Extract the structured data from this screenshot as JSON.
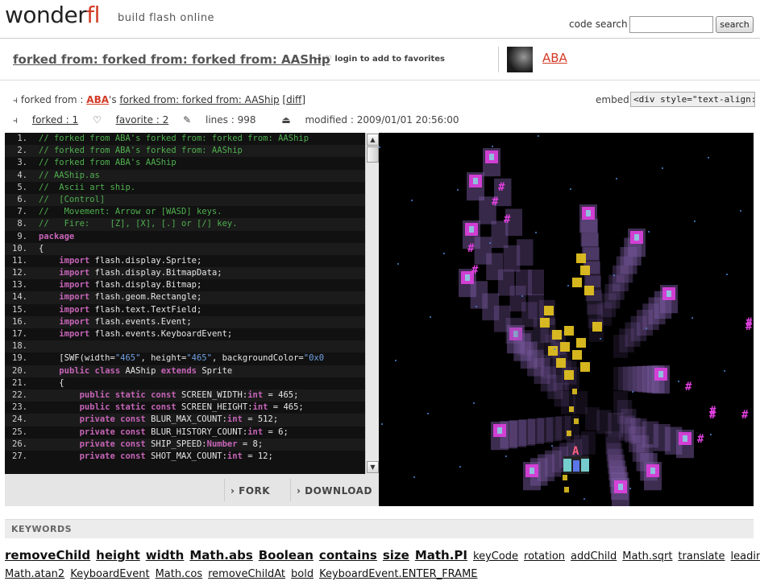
{
  "header": {
    "logo_main": "wonder",
    "logo_accent": "fl",
    "tagline": "build flash online",
    "search_label": "code search",
    "search_button": "search"
  },
  "title": {
    "text": "forked from: forked from: forked from: AAShip",
    "favorite_link": "login to add to favorites",
    "author": "ABA"
  },
  "info": {
    "forked_from_label": "forked from :",
    "forked_from_user": "ABA",
    "possessive": "'s",
    "forked_from_title": "forked from: forked from: AAShip",
    "diff": "[diff]",
    "embed_label": "embed",
    "embed_value": "<div style=\"text-align:center",
    "forked_count": "forked : 1",
    "favorite_count": "favorite : 2",
    "lines": "lines : 998",
    "modified": "modified : 2009/01/01 20:56:00"
  },
  "code": {
    "lines": [
      {
        "n": "1.",
        "parts": [
          {
            "t": "// forked from ABA's forked from: forked from: AAShip",
            "c": "com"
          }
        ]
      },
      {
        "n": "2.",
        "parts": [
          {
            "t": "// forked from ABA's forked from: AAShip",
            "c": "com"
          }
        ]
      },
      {
        "n": "3.",
        "parts": [
          {
            "t": "// forked from ABA's AAShip",
            "c": "com"
          }
        ]
      },
      {
        "n": "4.",
        "parts": [
          {
            "t": "// AAShip.as",
            "c": "com"
          }
        ]
      },
      {
        "n": "5.",
        "parts": [
          {
            "t": "//  Ascii art ship.",
            "c": "com"
          }
        ]
      },
      {
        "n": "6.",
        "parts": [
          {
            "t": "//  [Control]",
            "c": "com"
          }
        ]
      },
      {
        "n": "7.",
        "parts": [
          {
            "t": "//   Movement: Arrow or [WASD] keys.",
            "c": "com"
          }
        ]
      },
      {
        "n": "8.",
        "parts": [
          {
            "t": "//   Fire:    [Z], [X], [.] or [/] key.",
            "c": "com"
          }
        ]
      },
      {
        "n": "9.",
        "parts": [
          {
            "t": "package",
            "c": "kw"
          }
        ]
      },
      {
        "n": "10.",
        "parts": [
          {
            "t": "{",
            "c": ""
          }
        ]
      },
      {
        "n": "11.",
        "parts": [
          {
            "t": "    ",
            "c": ""
          },
          {
            "t": "import",
            "c": "kw"
          },
          {
            "t": " flash.display.Sprite;",
            "c": ""
          }
        ]
      },
      {
        "n": "12.",
        "parts": [
          {
            "t": "    ",
            "c": ""
          },
          {
            "t": "import",
            "c": "kw"
          },
          {
            "t": " flash.display.BitmapData;",
            "c": ""
          }
        ]
      },
      {
        "n": "13.",
        "parts": [
          {
            "t": "    ",
            "c": ""
          },
          {
            "t": "import",
            "c": "kw"
          },
          {
            "t": " flash.display.Bitmap;",
            "c": ""
          }
        ]
      },
      {
        "n": "14.",
        "parts": [
          {
            "t": "    ",
            "c": ""
          },
          {
            "t": "import",
            "c": "kw"
          },
          {
            "t": " flash.geom.Rectangle;",
            "c": ""
          }
        ]
      },
      {
        "n": "15.",
        "parts": [
          {
            "t": "    ",
            "c": ""
          },
          {
            "t": "import",
            "c": "kw"
          },
          {
            "t": " flash.text.TextField;",
            "c": ""
          }
        ]
      },
      {
        "n": "16.",
        "parts": [
          {
            "t": "    ",
            "c": ""
          },
          {
            "t": "import",
            "c": "kw"
          },
          {
            "t": " flash.events.Event;",
            "c": ""
          }
        ]
      },
      {
        "n": "17.",
        "parts": [
          {
            "t": "    ",
            "c": ""
          },
          {
            "t": "import",
            "c": "kw"
          },
          {
            "t": " flash.events.KeyboardEvent;",
            "c": ""
          }
        ]
      },
      {
        "n": "18.",
        "parts": [
          {
            "t": "",
            "c": ""
          }
        ]
      },
      {
        "n": "19.",
        "parts": [
          {
            "t": "    [SWF(width=",
            "c": ""
          },
          {
            "t": "\"465\"",
            "c": "str"
          },
          {
            "t": ", height=",
            "c": ""
          },
          {
            "t": "\"465\"",
            "c": "str"
          },
          {
            "t": ", backgroundColor=",
            "c": ""
          },
          {
            "t": "\"0x0",
            "c": "str"
          }
        ]
      },
      {
        "n": "20.",
        "parts": [
          {
            "t": "    ",
            "c": ""
          },
          {
            "t": "public class",
            "c": "kw"
          },
          {
            "t": " AAShip ",
            "c": ""
          },
          {
            "t": "extends",
            "c": "kw"
          },
          {
            "t": " Sprite",
            "c": ""
          }
        ]
      },
      {
        "n": "21.",
        "parts": [
          {
            "t": "    {",
            "c": ""
          }
        ]
      },
      {
        "n": "22.",
        "parts": [
          {
            "t": "        ",
            "c": ""
          },
          {
            "t": "public static const",
            "c": "kw"
          },
          {
            "t": " SCREEN_WIDTH:",
            "c": ""
          },
          {
            "t": "int",
            "c": "kw"
          },
          {
            "t": " = 465;",
            "c": ""
          }
        ]
      },
      {
        "n": "23.",
        "parts": [
          {
            "t": "        ",
            "c": ""
          },
          {
            "t": "public static const",
            "c": "kw"
          },
          {
            "t": " SCREEN_HEIGHT:",
            "c": ""
          },
          {
            "t": "int",
            "c": "kw"
          },
          {
            "t": " = 465;",
            "c": ""
          }
        ]
      },
      {
        "n": "24.",
        "parts": [
          {
            "t": "        ",
            "c": ""
          },
          {
            "t": "private const",
            "c": "kw"
          },
          {
            "t": " BLUR_MAX_COUNT:",
            "c": ""
          },
          {
            "t": "int",
            "c": "kw"
          },
          {
            "t": " = 512;",
            "c": ""
          }
        ]
      },
      {
        "n": "25.",
        "parts": [
          {
            "t": "        ",
            "c": ""
          },
          {
            "t": "private const",
            "c": "kw"
          },
          {
            "t": " BLUR_HISTORY_COUNT:",
            "c": ""
          },
          {
            "t": "int",
            "c": "kw"
          },
          {
            "t": " = 6;",
            "c": ""
          }
        ]
      },
      {
        "n": "26.",
        "parts": [
          {
            "t": "        ",
            "c": ""
          },
          {
            "t": "private const",
            "c": "kw"
          },
          {
            "t": " SHIP_SPEED:",
            "c": ""
          },
          {
            "t": "Number",
            "c": "kw"
          },
          {
            "t": " = 8;",
            "c": ""
          }
        ]
      },
      {
        "n": "27.",
        "parts": [
          {
            "t": "        ",
            "c": ""
          },
          {
            "t": "private const",
            "c": "kw"
          },
          {
            "t": " SHOT_MAX_COUNT:",
            "c": ""
          },
          {
            "t": "int",
            "c": "kw"
          },
          {
            "t": " = 12;",
            "c": ""
          }
        ]
      }
    ]
  },
  "actions": {
    "fork": "FORK",
    "download": "DOWNLOAD"
  },
  "keywords": {
    "header": "KEYWORDS",
    "row1_big": [
      "removeChild",
      "height",
      "width",
      "Math.abs",
      "Boolean",
      "contains",
      "size",
      "Math.PI"
    ],
    "row1_small": [
      "keyCode",
      "rotation",
      "addChild",
      "Math.sqrt",
      "translate",
      "leading"
    ],
    "row2_small": [
      "Math.atan2",
      "KeyboardEvent",
      "Math.cos",
      "removeChildAt",
      "bold",
      "KeyboardEvent.ENTER_FRAME"
    ]
  },
  "canvas": {
    "ship_glyph": "A",
    "bullet_glyph": "#",
    "colors": {
      "background": "#000000",
      "magenta": "#e040e0",
      "yellow": "#e0c020",
      "cyan": "#80e0e0",
      "trail": "#7a5aa0"
    }
  }
}
